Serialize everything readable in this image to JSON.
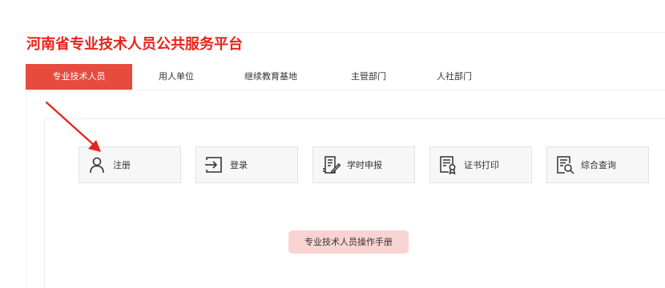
{
  "header": {
    "site_title": "河南省专业技术人员公共服务平台"
  },
  "nav": {
    "tabs": [
      {
        "label": "专业技术人员",
        "active": true
      },
      {
        "label": "用人单位",
        "active": false
      },
      {
        "label": "继续教育基地",
        "active": false
      },
      {
        "label": "主管部门",
        "active": false
      },
      {
        "label": "人社部门",
        "active": false
      }
    ]
  },
  "functions": [
    {
      "label": "注册",
      "icon": "user-icon"
    },
    {
      "label": "登录",
      "icon": "login-icon"
    },
    {
      "label": "学时申报",
      "icon": "document-edit-icon"
    },
    {
      "label": "证书打印",
      "icon": "certificate-icon"
    },
    {
      "label": "综合查询",
      "icon": "document-search-icon"
    }
  ],
  "manual": {
    "label": "专业技术人员操作手册"
  },
  "colors": {
    "title_red": "#e8231b",
    "active_tab": "#e64b3e",
    "manual_bg": "#f9d3d2",
    "arrow_red": "#e8231b"
  }
}
